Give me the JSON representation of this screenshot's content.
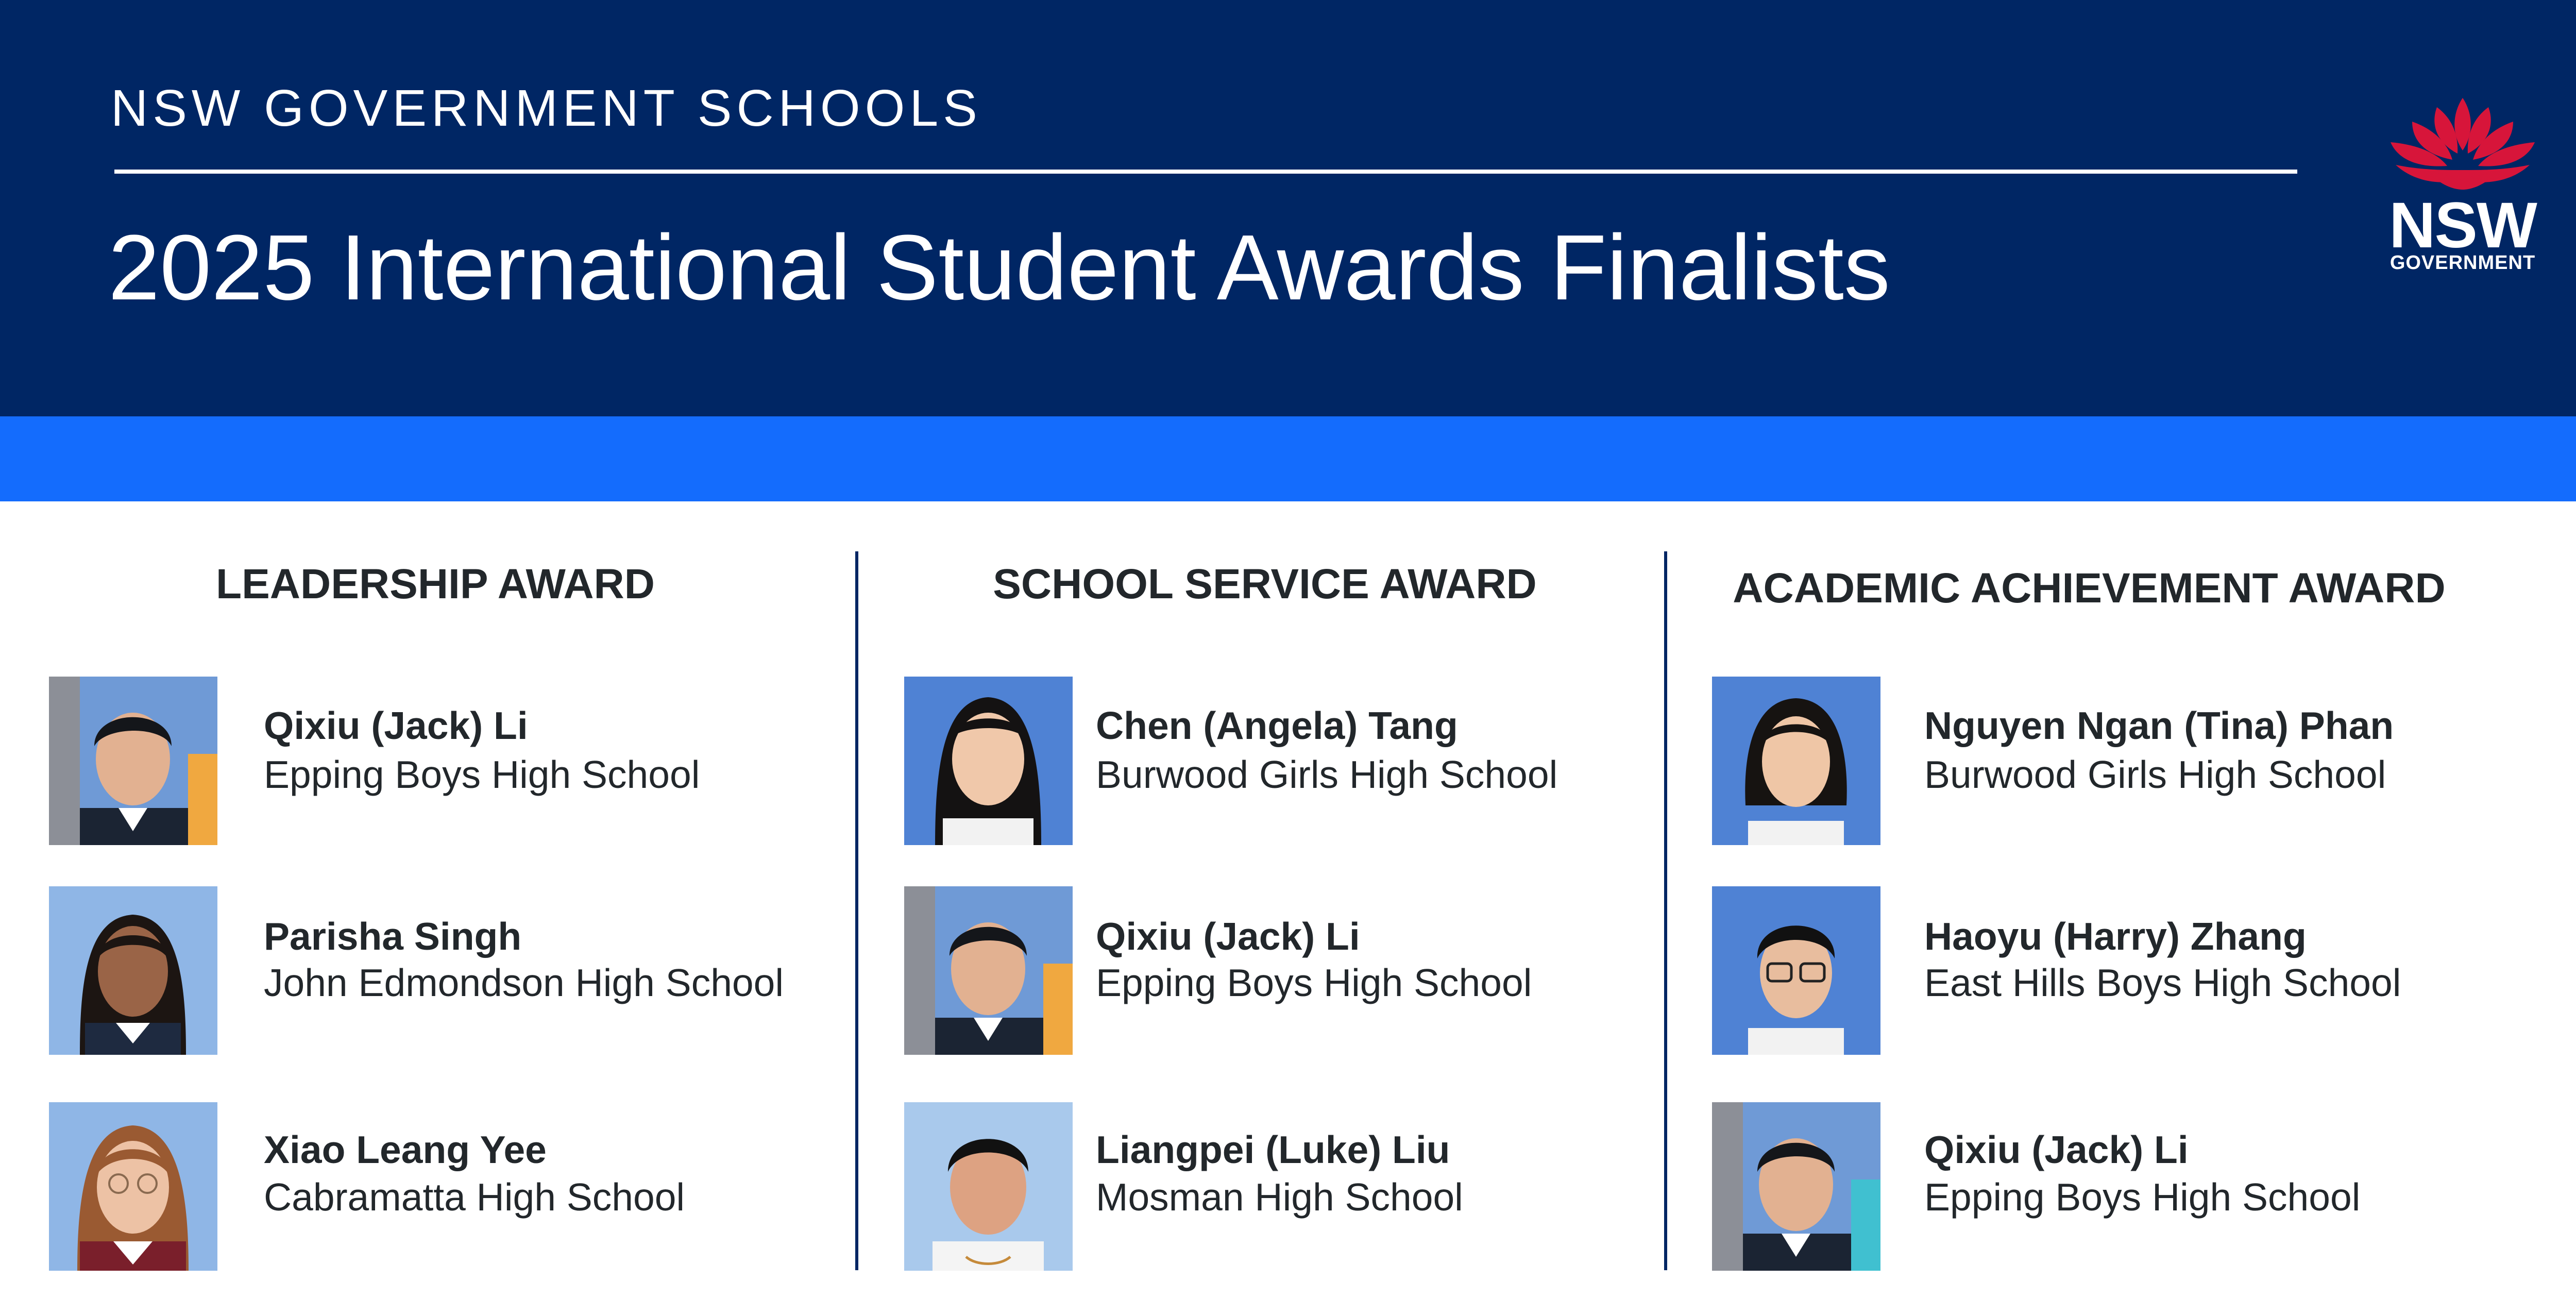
{
  "header": {
    "kicker": "NSW GOVERNMENT SCHOOLS",
    "title": "2025 International Student Awards Finalists",
    "logo": {
      "word": "NSW",
      "sub": "GOVERNMENT",
      "flower_color": "#d7153a"
    }
  },
  "colors": {
    "navy": "#002664",
    "blue": "#146cfd",
    "text": "#22272b",
    "photo_bg": "#6f9ad6"
  },
  "awards": [
    {
      "title": "LEADERSHIP AWARD",
      "finalists": [
        {
          "name": "Qixiu (Jack) Li",
          "school": "Epping Boys High School"
        },
        {
          "name": "Parisha Singh",
          "school": "John Edmondson High School"
        },
        {
          "name": "Xiao Leang Yee",
          "school": "Cabramatta High School"
        }
      ]
    },
    {
      "title": "SCHOOL SERVICE AWARD",
      "finalists": [
        {
          "name": "Chen (Angela) Tang",
          "school": "Burwood Girls High School"
        },
        {
          "name": "Qixiu (Jack) Li",
          "school": "Epping Boys High School"
        },
        {
          "name": "Liangpei (Luke) Liu",
          "school": "Mosman High School"
        }
      ]
    },
    {
      "title": "ACADEMIC ACHIEVEMENT AWARD",
      "finalists": [
        {
          "name": "Nguyen Ngan (Tina) Phan",
          "school": "Burwood Girls High School"
        },
        {
          "name": "Haoyu (Harry) Zhang",
          "school": "East Hills Boys High School"
        },
        {
          "name": "Qixiu (Jack) Li",
          "school": "Epping Boys High School"
        }
      ]
    }
  ]
}
